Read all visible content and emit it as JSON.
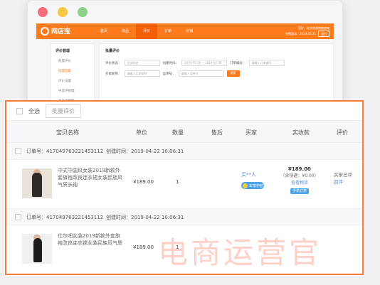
{
  "app": {
    "logo_text": "网店宝",
    "nav": [
      "首页",
      "商品",
      "评价",
      "订单",
      "店铺"
    ],
    "active_nav_index": 2,
    "user_line1": "您好，北京旅游购物商城",
    "user_line2": "免费版本：2019.05.31",
    "user_action": "退出"
  },
  "sidebar": {
    "heading": "评价管理",
    "items": [
      "批量评价",
      "批量回复",
      "评价设置",
      "中差评管理",
      "中差评预警"
    ],
    "active_index": 1
  },
  "filters": {
    "title": "批量评价",
    "row1": [
      {
        "label": "评价状态：",
        "value": "全部状态"
      },
      {
        "label": "创建时间：",
        "value": "2019-03-20 ~ 2019-04-30"
      },
      {
        "label": "订单编号：",
        "value": "请输入订单编号"
      }
    ],
    "row2": [
      {
        "label": "买家昵称：",
        "value": "请输入买家昵称"
      },
      {
        "label": "运单号：",
        "value": "请输入运单号"
      }
    ],
    "search_button": "搜索"
  },
  "toolbar": {
    "select_all": "全选",
    "batch_review": "批量评价"
  },
  "table": {
    "columns": [
      "宝贝名称",
      "单价",
      "数量",
      "售后",
      "买家",
      "实收款",
      "评价"
    ]
  },
  "orders": [
    {
      "order_no": "订单号：417049763221453112",
      "created": "创建时间：2019-04-22 10:06:31",
      "title": "中式中国风女装2019新款外套旗袍改良连衣裙女装民族风气质长袖",
      "price": "¥189.00",
      "qty": "1",
      "buyer": "买**人",
      "buyer_badge": "车享护航",
      "amount": "¥189.00",
      "amount_note": "（含快递：¥0.00）",
      "detail_link": "查看物流",
      "pay_tag": "手机订单",
      "review_status": "买家已评",
      "review_link": "回评"
    },
    {
      "order_no": "订单号：417049763221453112",
      "created": "创建时间：2019-04-22 10:06:31",
      "title": "仕尔吧女装2019新款外套旗袍改良连衣裙女装民族风气质",
      "price": "¥189.00",
      "qty": "1"
    }
  ],
  "watermark": "电商运营官",
  "colors": {
    "brand_orange": "#ff7a1a",
    "highlight_border": "#ff7f3a",
    "link_blue": "#5a8bd6"
  }
}
